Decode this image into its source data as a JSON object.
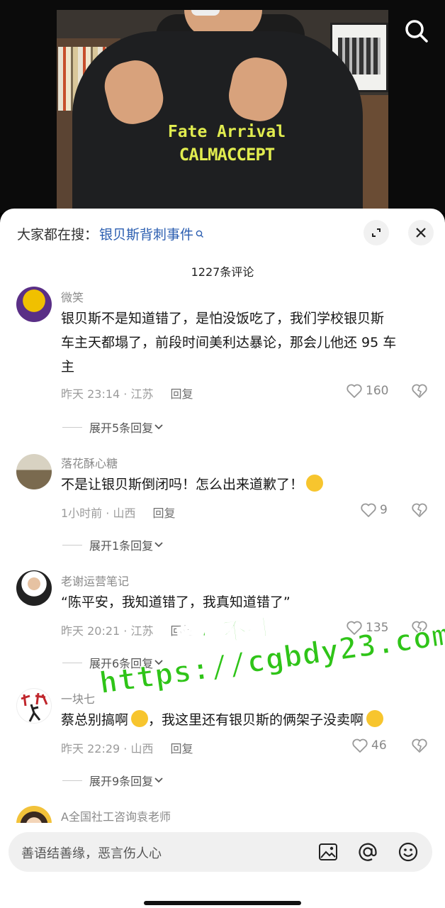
{
  "video": {
    "shirt_line1": "Fate Arrival",
    "shirt_line2": "CALMACCEPT",
    "search_icon": "search-icon"
  },
  "panel": {
    "suggest_prefix": "大家都在搜：",
    "suggest_term": "银贝斯背刺事件",
    "comment_count": "1227条评论"
  },
  "comments": [
    {
      "username": "微笑",
      "text_line1": "银贝斯不是知道错了，是怕没饭吃了，我们学校银贝斯",
      "text_line2": "车主天都塌了，前段时间美利达暴论，那会儿他还 95 车",
      "text_line3": "主",
      "time": "昨天 23:14 · 江苏",
      "reply": "回复",
      "likes": "160",
      "expand": "展开5条回复"
    },
    {
      "username": "落花酥心糖",
      "text": "不是让银贝斯倒闭吗！怎么出来道歉了！",
      "time": "1小时前 · 山西",
      "reply": "回复",
      "likes": "9",
      "expand": "展开1条回复"
    },
    {
      "username": "老谢运营笔记",
      "text": "“陈平安，我知道错了，我真知道错了”",
      "time": "昨天 20:21 · 江苏",
      "reply": "回复",
      "likes": "135",
      "expand": "展开6条回复"
    },
    {
      "username": "一块七",
      "text_a": "蔡总别搞啊",
      "text_b": "，我这里还有银贝斯的俩架子没卖啊",
      "time": "昨天 22:29 · 山西",
      "reply": "回复",
      "likes": "46",
      "expand": "展开9条回复"
    },
    {
      "username": "A全国社工咨询袁老师"
    }
  ],
  "watermark": {
    "line1": "黑料不打烊",
    "line2": "https://cgbdy23.com"
  },
  "input": {
    "placeholder": "善语结善缘，恶言伤人心"
  }
}
